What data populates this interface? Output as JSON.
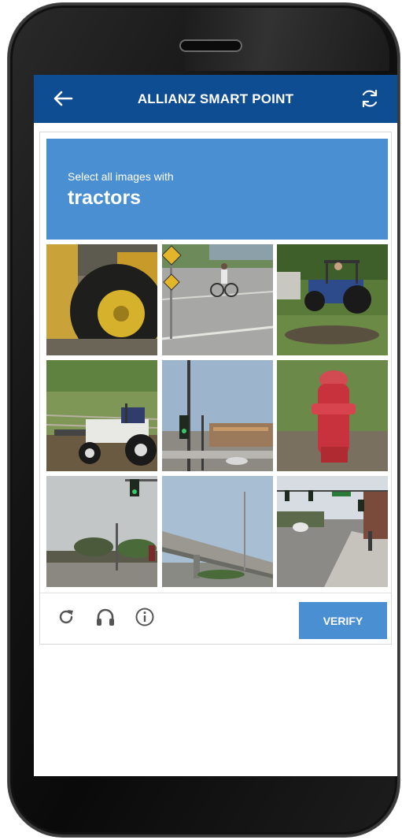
{
  "header": {
    "title": "ALLIANZ SMART POINT",
    "back_icon": "arrow-left-icon",
    "refresh_icon": "refresh-icon",
    "color": "#0f4d92"
  },
  "captcha": {
    "instruction": "Select all images with",
    "target": "tractors",
    "accent_color": "#4a8fd1",
    "tiles": [
      {
        "name": "tile-tractor-wheel-closeup"
      },
      {
        "name": "tile-cyclist-road-sign"
      },
      {
        "name": "tile-blue-tractor-field"
      },
      {
        "name": "tile-white-tractor-loader"
      },
      {
        "name": "tile-street-lamp-traffic-light"
      },
      {
        "name": "tile-red-fire-hydrant"
      },
      {
        "name": "tile-traffic-light-trees"
      },
      {
        "name": "tile-highway-overpass"
      },
      {
        "name": "tile-street-traffic-lights"
      }
    ],
    "footer": {
      "reload_icon": "reload-icon",
      "audio_icon": "headphones-icon",
      "info_icon": "info-icon",
      "verify_label": "VERIFY"
    }
  }
}
